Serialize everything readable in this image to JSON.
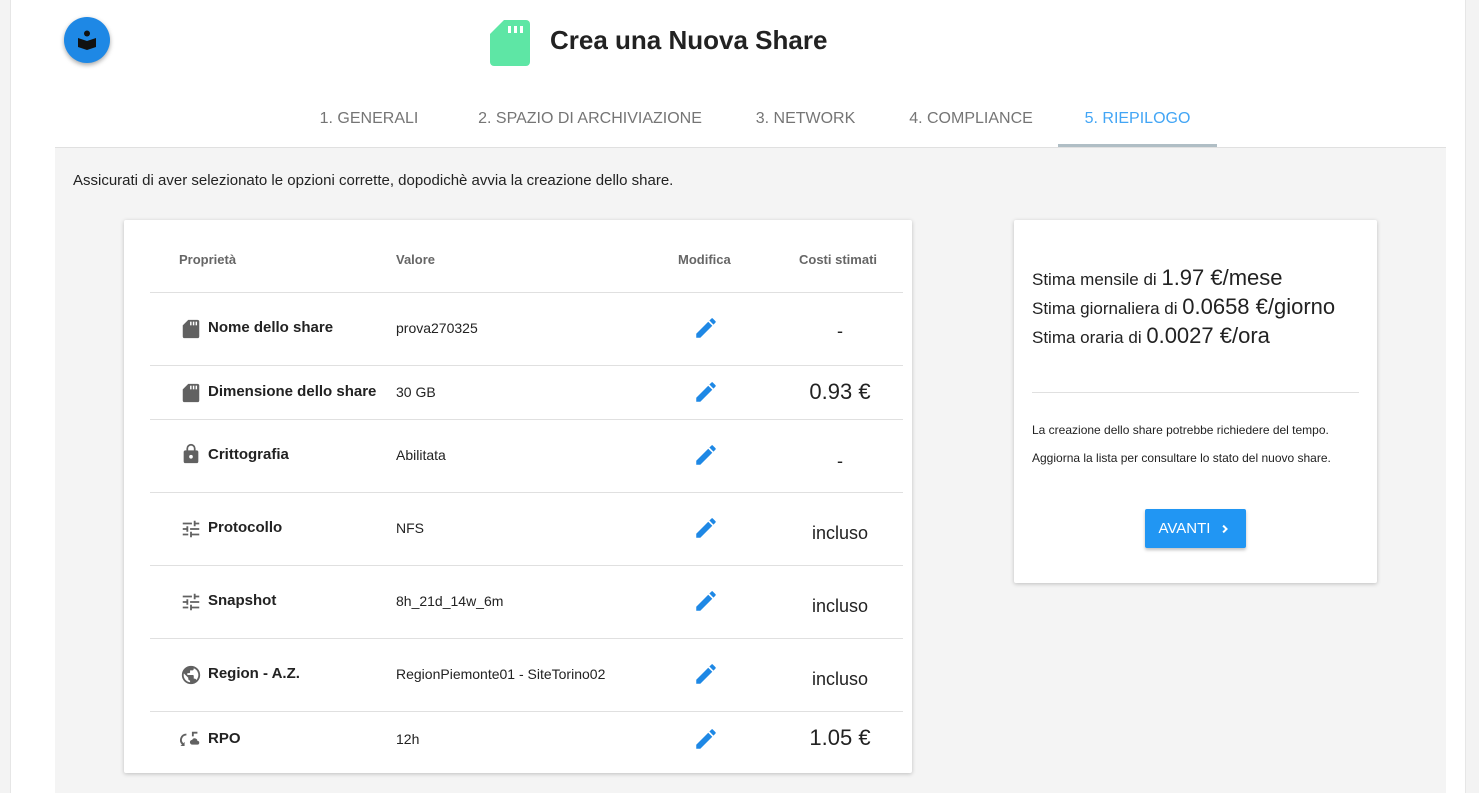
{
  "header": {
    "title": "Crea una Nuova Share"
  },
  "tabs": [
    {
      "label": "1. GENERALI"
    },
    {
      "label": "2. SPAZIO DI ARCHIVIAZIONE"
    },
    {
      "label": "3. NETWORK"
    },
    {
      "label": "4. COMPLIANCE"
    },
    {
      "label": "5. RIEPILOGO",
      "active": true
    }
  ],
  "instruction": "Assicurati di aver selezionato le opzioni corrette, dopodichè avvia la creazione dello share.",
  "table": {
    "headers": {
      "property": "Proprietà",
      "value": "Valore",
      "edit": "Modifica",
      "cost": "Costi stimati"
    },
    "rows": [
      {
        "icon": "sd-card-icon",
        "property": "Nome dello share",
        "value": "prova270325",
        "cost": "-"
      },
      {
        "icon": "sd-card-icon",
        "property": "Dimensione dello share",
        "value": "30 GB",
        "cost": "0.93 €"
      },
      {
        "icon": "lock-icon",
        "property": "Crittografia",
        "value": "Abilitata",
        "cost": "-"
      },
      {
        "icon": "tune-icon",
        "property": "Protocollo",
        "value": "NFS",
        "cost": "incluso"
      },
      {
        "icon": "tune-icon",
        "property": "Snapshot",
        "value": "8h_21d_14w_6m",
        "cost": "incluso"
      },
      {
        "icon": "globe-icon",
        "property": "Region - A.Z.",
        "value": "RegionPiemonte01 - SiteTorino02",
        "cost": "incluso"
      },
      {
        "icon": "restore-cloud-icon",
        "property": "RPO",
        "value": "12h",
        "cost": "1.05 €"
      }
    ]
  },
  "summary": {
    "monthly_label": "Stima mensile di",
    "monthly_value": "1.97 €/mese",
    "daily_label": "Stima giornaliera di",
    "daily_value": "0.0658 €/giorno",
    "hourly_label": "Stima oraria di",
    "hourly_value": "0.0027 €/ora",
    "note_1": "La creazione dello share potrebbe richiedere del tempo.",
    "note_2": "Aggiorna la lista per consultare lo stato del nuovo share.",
    "button_label": "AVANTI"
  },
  "colors": {
    "accent": "#2196f3",
    "header_icon": "#5ee6a5",
    "fab": "#1e88e5"
  }
}
